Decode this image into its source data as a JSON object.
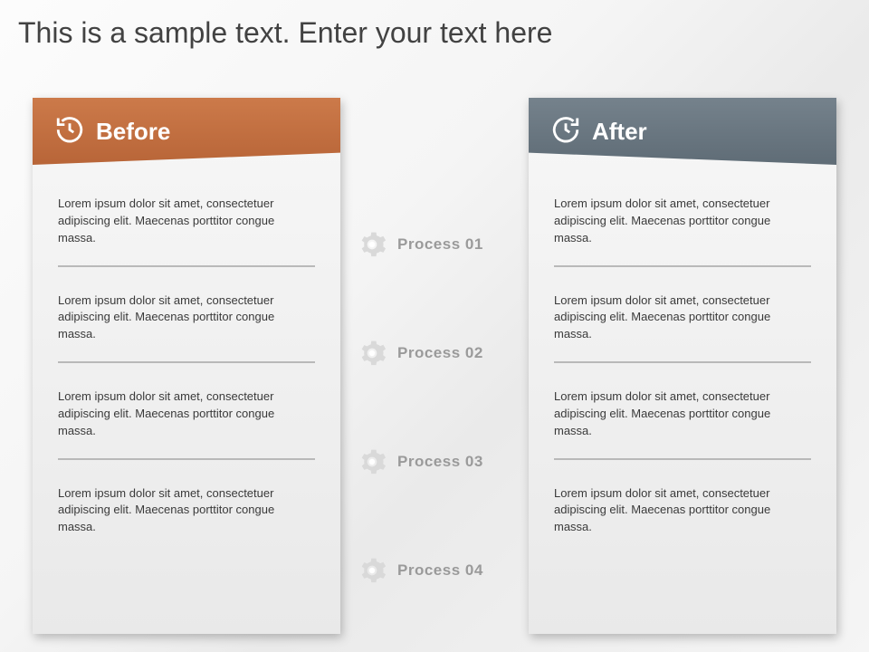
{
  "title": "This is a sample text. Enter your text here",
  "colors": {
    "before_header": "#bf6a3c",
    "after_header": "#6a7882",
    "process_text": "#9a9a9a",
    "body_text": "#3a3a3a"
  },
  "before": {
    "label": "Before",
    "icon": "history-clock-icon",
    "items": [
      "Lorem ipsum dolor sit amet, consectetuer adipiscing elit. Maecenas porttitor congue massa.",
      "Lorem ipsum dolor sit amet, consectetuer adipiscing elit. Maecenas porttitor congue massa.",
      "Lorem ipsum dolor sit amet, consectetuer adipiscing elit. Maecenas porttitor congue massa.",
      "Lorem ipsum dolor sit amet, consectetuer adipiscing elit. Maecenas porttitor congue massa."
    ]
  },
  "after": {
    "label": "After",
    "icon": "refresh-clock-icon",
    "items": [
      "Lorem ipsum dolor sit amet, consectetuer adipiscing elit. Maecenas porttitor congue massa.",
      "Lorem ipsum dolor sit amet, consectetuer adipiscing elit. Maecenas porttitor congue massa.",
      "Lorem ipsum dolor sit amet, consectetuer adipiscing elit. Maecenas porttitor congue massa.",
      "Lorem ipsum dolor sit amet, consectetuer adipiscing elit. Maecenas porttitor congue massa."
    ]
  },
  "processes": [
    {
      "icon": "gear-icon",
      "label": "Process 01"
    },
    {
      "icon": "gear-icon",
      "label": "Process 02"
    },
    {
      "icon": "gear-icon",
      "label": "Process 03"
    },
    {
      "icon": "gear-icon",
      "label": "Process 04"
    }
  ]
}
